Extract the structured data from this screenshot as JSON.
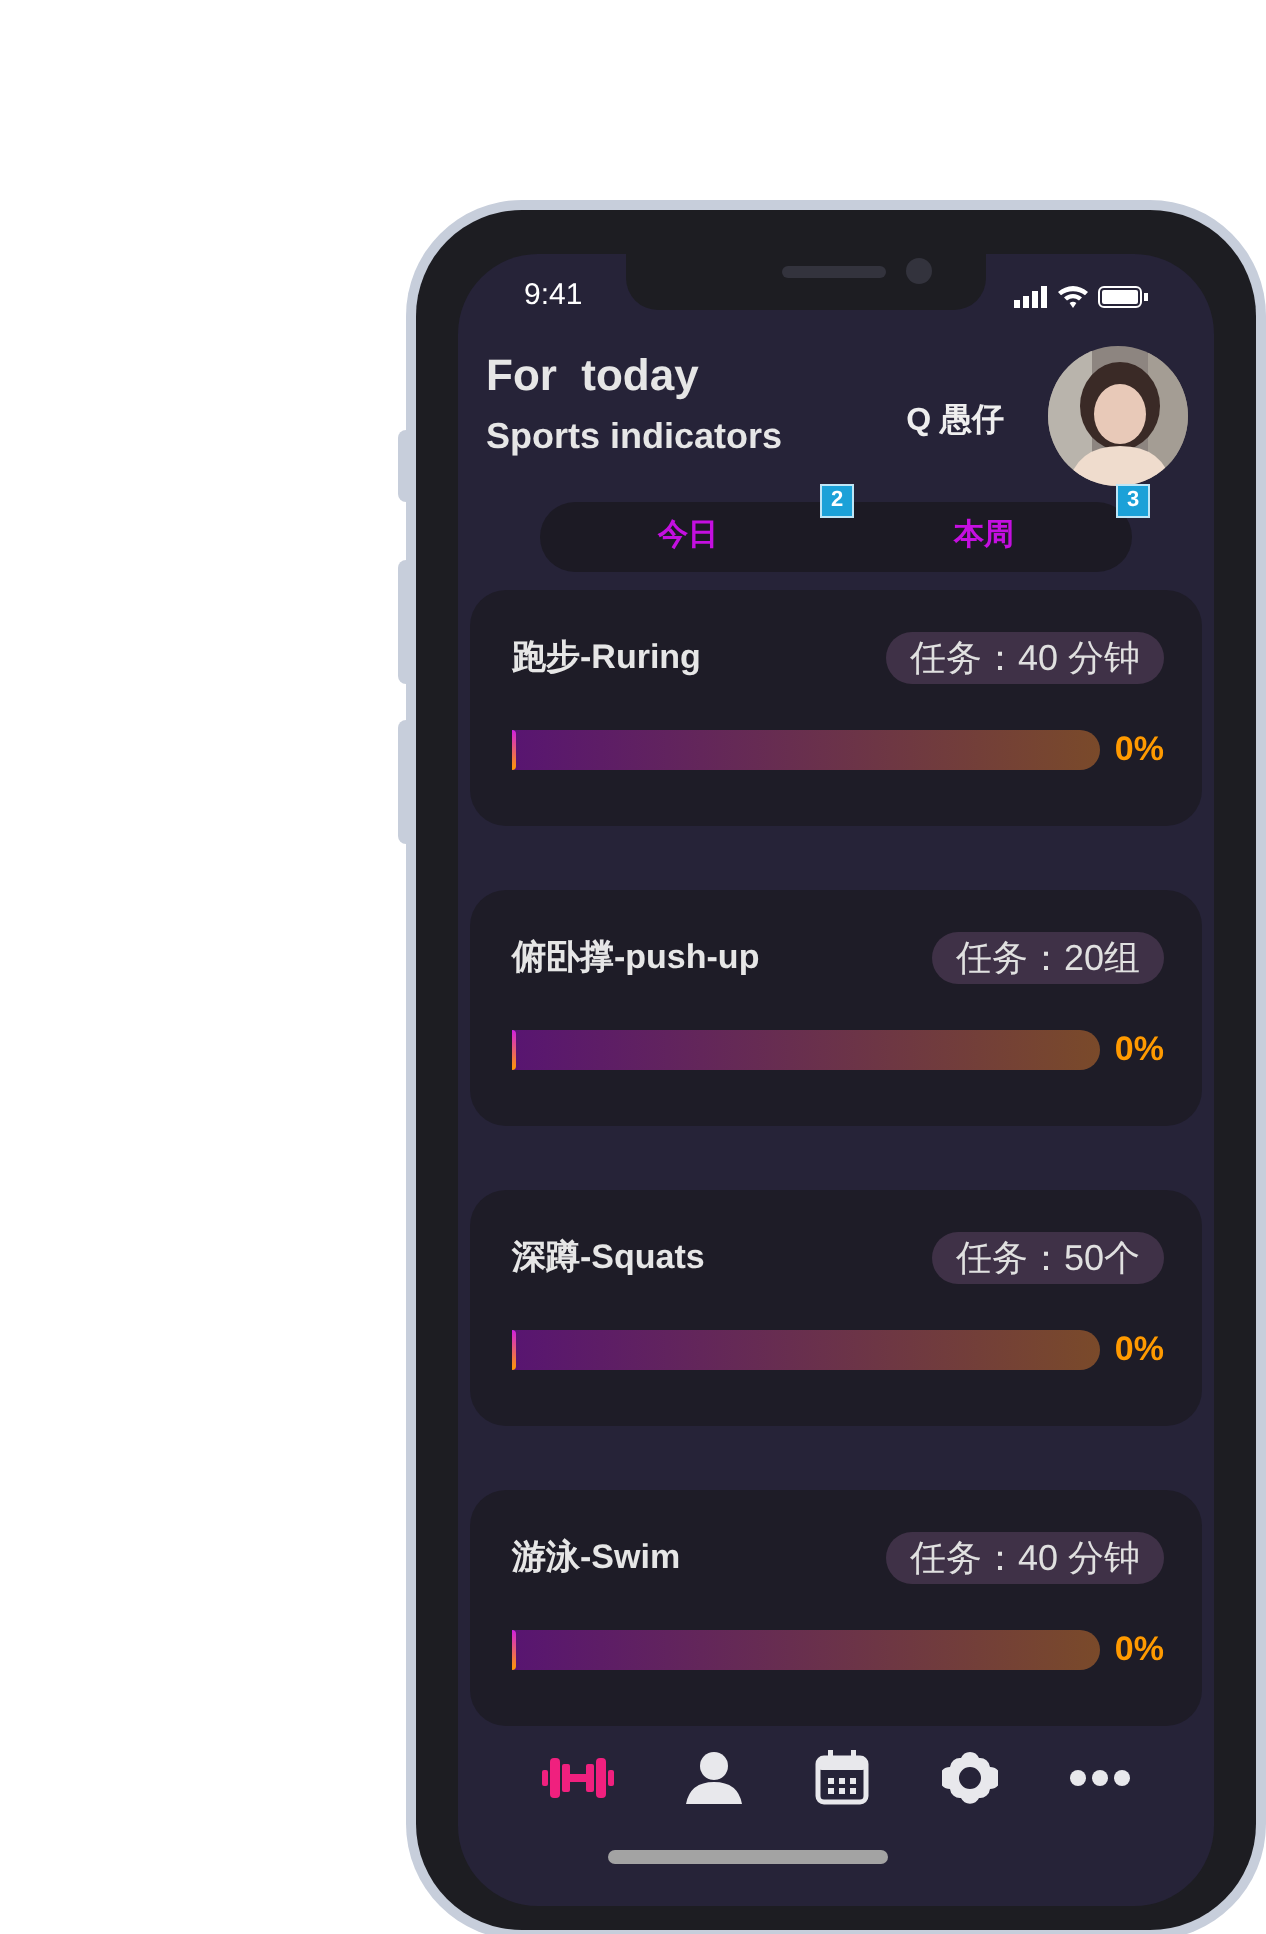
{
  "status_bar": {
    "time": "9:41"
  },
  "header": {
    "title": "For  today",
    "subtitle": "Sports indicators",
    "user": "Q 愚仔"
  },
  "tabs": [
    {
      "label": "今日",
      "marker": "2"
    },
    {
      "label": "本周",
      "marker": "3"
    }
  ],
  "tasks": [
    {
      "name": "跑步-Ruring",
      "goal": "任务：40 分钟",
      "level": 0,
      "reading": "0%"
    },
    {
      "name": "俯卧撑-push-up",
      "goal": "任务：20组",
      "level": 0,
      "reading": "0%"
    },
    {
      "name": "深蹲-Squats",
      "goal": "任务：50个",
      "level": 0,
      "reading": "0%"
    },
    {
      "name": "游泳-Swim",
      "goal": "任务：40 分钟",
      "level": 0,
      "reading": "0%"
    }
  ],
  "nav": [
    {
      "kind": "dumbbell",
      "active": true
    },
    {
      "kind": "person",
      "active": false
    },
    {
      "kind": "calendar",
      "active": false
    },
    {
      "kind": "gear",
      "active": false
    },
    {
      "kind": "more",
      "active": false
    }
  ]
}
